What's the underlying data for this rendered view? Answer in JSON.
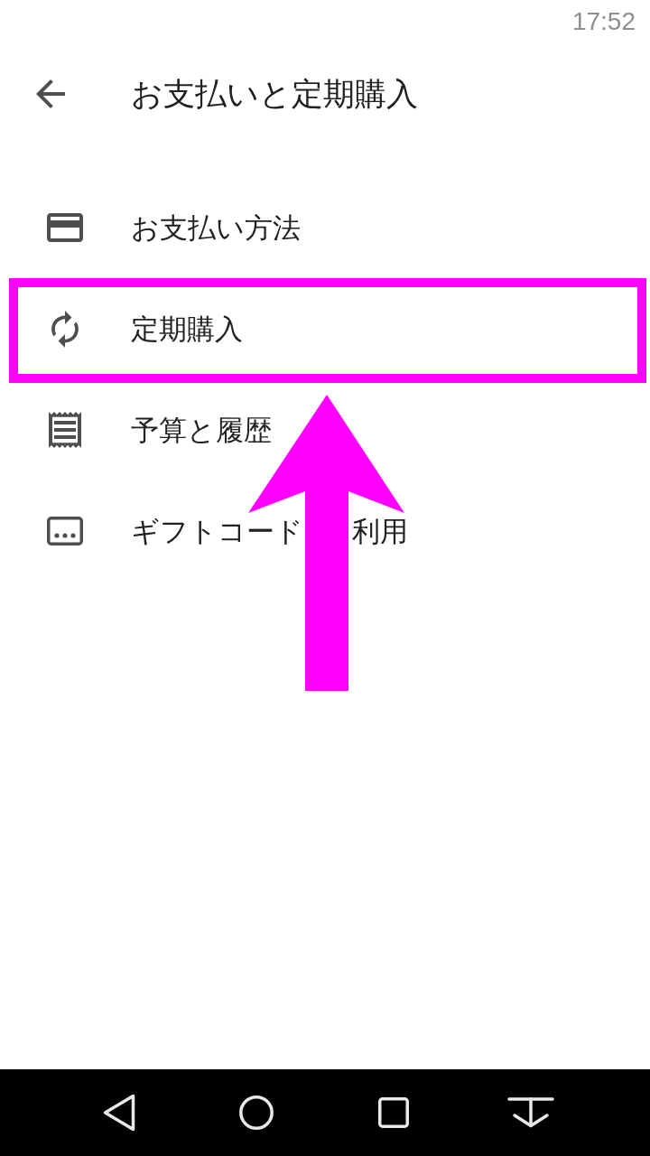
{
  "status_bar": {
    "time": "17:52"
  },
  "app_bar": {
    "title": "お支払いと定期購入"
  },
  "items": [
    {
      "kind": "payment",
      "label": "お支払い方法",
      "highlighted": false
    },
    {
      "kind": "subscription",
      "label": "定期購入",
      "highlighted": true
    },
    {
      "kind": "budget",
      "label": "予算と履歴",
      "highlighted": false
    },
    {
      "kind": "giftcode",
      "label": "ギフトコード",
      "label_tail": "利用",
      "highlighted": false
    }
  ]
}
